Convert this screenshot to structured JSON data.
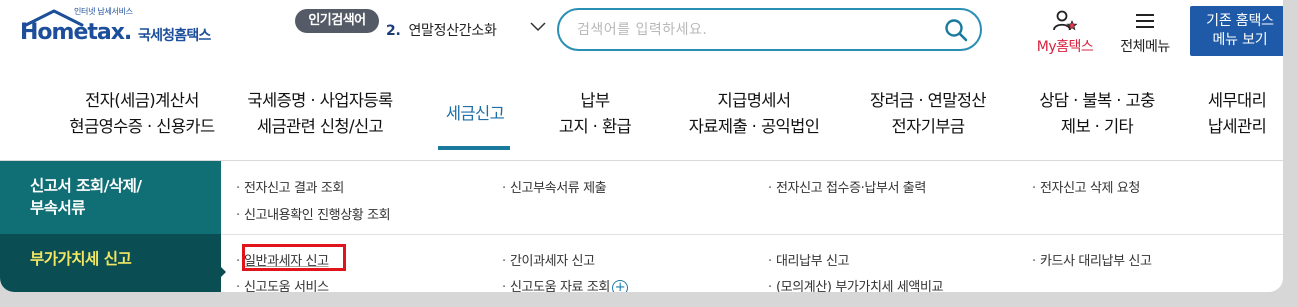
{
  "header": {
    "logo_tagline": "인터넷 납세서비스",
    "logo_main": "Hometax.",
    "logo_sub": "국세청홈택스",
    "hot_search": {
      "badge": "인기검색어",
      "rank": "2.",
      "term": "연말정산간소화"
    },
    "search": {
      "placeholder": "검색어를 입력하세요."
    },
    "my_hometax": "My홈택스",
    "all_menu": "전체메뉴",
    "legacy_line1": "기존 홈택스",
    "legacy_line2": "메뉴 보기"
  },
  "gnb": [
    {
      "line1": "전자(세금)계산서",
      "line2": "현금영수증 · 신용카드",
      "active": false
    },
    {
      "line1": "국세증명 · 사업자등록",
      "line2": "세금관련 신청/신고",
      "active": false
    },
    {
      "line1": "세금신고",
      "line2": "",
      "active": true
    },
    {
      "line1": "납부",
      "line2": "고지 · 환급",
      "active": false
    },
    {
      "line1": "지급명세서",
      "line2": "자료제출 · 공익법인",
      "active": false
    },
    {
      "line1": "장려금 · 연말정산",
      "line2": "전자기부금",
      "active": false
    },
    {
      "line1": "상담 · 불복 · 고충",
      "line2": "제보 · 기타",
      "active": false
    },
    {
      "line1": "세무대리",
      "line2": "납세관리",
      "active": false
    }
  ],
  "submenu": {
    "categories": [
      {
        "line1": "신고서 조회/삭제/",
        "line2": "부속서류"
      },
      {
        "line1": "부가가치세 신고"
      }
    ],
    "group1": [
      "전자신고 결과 조회",
      "신고부속서류 제출",
      "전자신고 접수증·납부서 출력",
      "전자신고 삭제 요청",
      "신고내용확인 진행상황 조회"
    ],
    "group2": [
      "일반과세자 신고",
      "간이과세자 신고",
      "대리납부 신고",
      "카드사 대리납부 신고",
      "신고도움 서비스",
      "신고도움 자료 조회",
      "(모의계산) 부가가치세 세액비교"
    ],
    "bullet": "·",
    "plus_icon": "+"
  },
  "colors": {
    "brand": "#1c4e9b",
    "accent": "#1a7a9e",
    "category_bg": "#0f6f74",
    "category_active_bg": "#0a4e53",
    "category_active_text": "#f2e663",
    "highlight": "#e0141b"
  }
}
